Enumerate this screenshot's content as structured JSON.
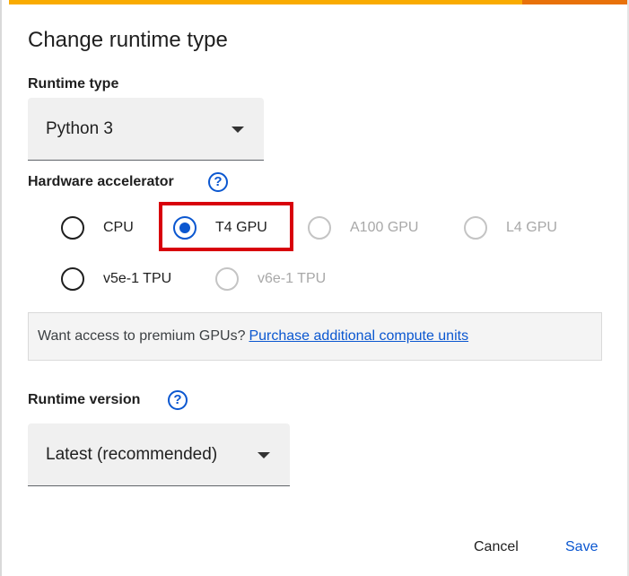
{
  "dialog": {
    "title": "Change runtime type"
  },
  "runtime_type": {
    "label": "Runtime type",
    "selected": "Python 3"
  },
  "hardware_accelerator": {
    "label": "Hardware accelerator",
    "help_icon": "help-circle-icon",
    "options": [
      {
        "label": "CPU",
        "state": "unselected"
      },
      {
        "label": "T4 GPU",
        "state": "selected"
      },
      {
        "label": "A100 GPU",
        "state": "disabled"
      },
      {
        "label": "L4 GPU",
        "state": "disabled"
      },
      {
        "label": "v5e-1 TPU",
        "state": "unselected"
      },
      {
        "label": "v6e-1 TPU",
        "state": "disabled"
      }
    ]
  },
  "premium_notice": {
    "text": "Want access to premium GPUs?",
    "link": "Purchase additional compute units"
  },
  "runtime_version": {
    "label": "Runtime version",
    "help_icon": "help-circle-icon",
    "selected": "Latest (recommended)"
  },
  "actions": {
    "cancel": "Cancel",
    "save": "Save"
  },
  "colors": {
    "accent": "#0b57d0",
    "highlight": "#d8000c",
    "disabled": "#a8a8a8"
  }
}
